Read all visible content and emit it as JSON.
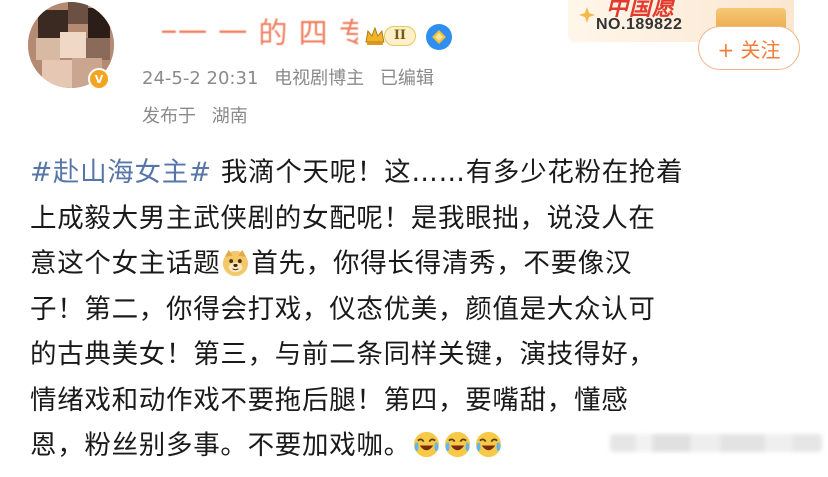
{
  "header": {
    "username": "一一 一 的 四 专",
    "rank_badge_label": "II",
    "meta_line1": [
      "24-5-2 20:31",
      "电视剧博主",
      "已编辑"
    ],
    "published_prefix": "发布于",
    "location": "湖南"
  },
  "promo": {
    "title": "中国愿",
    "number": "NO.189822"
  },
  "follow_button": {
    "label": "+ 关注"
  },
  "post": {
    "hashtag": "#赴山海女主#",
    "lines": [
      " 我滴个天呢！这……有多少花粉在抢着",
      "上成毅大男主武侠剧的女配呢！是我眼拙，说没人在",
      "意这个女主话题",
      "首先，你得长得清秀，不要像汉",
      "子！第二，你得会打戏，仪态优美，颜值是大众认可",
      "的古典美女！第三，与前二条同样关键，演技得好，",
      "情绪戏和动作戏不要拖后腿！第四，要嘴甜，懂感",
      "恩，粉丝别多事。不要加戏咖。"
    ],
    "emojis": {
      "doge": "doge-icon",
      "laugh_cry": "laugh-cry-icon"
    }
  },
  "colors": {
    "hashtag": "#5676a8",
    "meta": "#8a8a8a",
    "follow": "#f07d3a",
    "verify": "#2f8ef0"
  }
}
